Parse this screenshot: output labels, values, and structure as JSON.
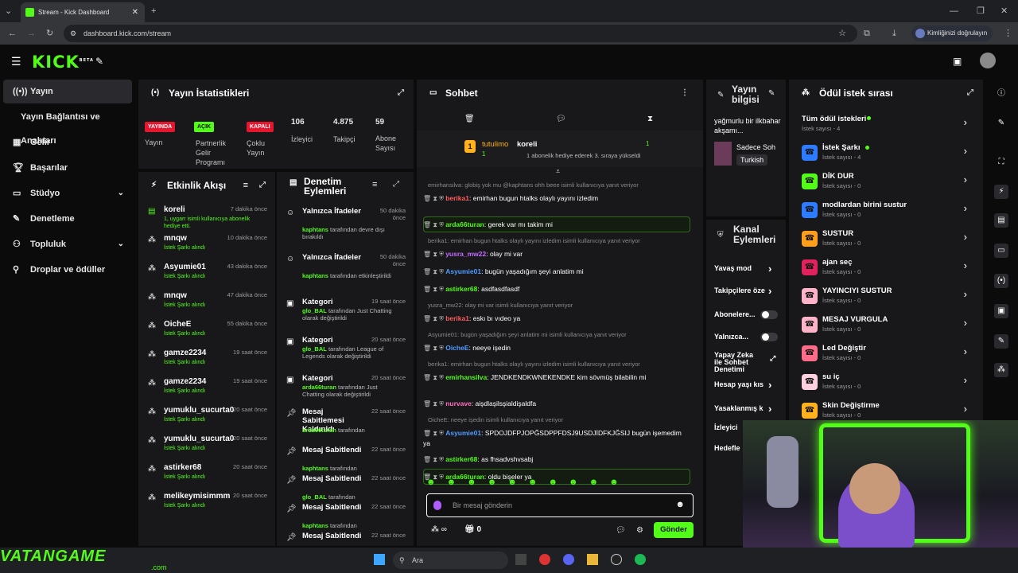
{
  "browser": {
    "tab_title": "Stream - Kick Dashboard",
    "url": "dashboard.kick.com/stream",
    "profile_label": "Kimliğinizi doğrulayın"
  },
  "app": {
    "logo": "KICK",
    "logo_sup": "BETA"
  },
  "sidebar": {
    "items": [
      {
        "label": "Yayın",
        "icon": "broadcast-icon"
      },
      {
        "label": "Yayın Bağlantısı ve Anahtarı",
        "icon": ""
      },
      {
        "label": "Gelir",
        "icon": "revenue-icon"
      },
      {
        "label": "Başarılar",
        "icon": "trophy-icon"
      },
      {
        "label": "Stüdyo",
        "icon": "studio-icon"
      },
      {
        "label": "Denetleme",
        "icon": "moderation-icon"
      },
      {
        "label": "Topluluk",
        "icon": "community-icon"
      },
      {
        "label": "Droplar ve ödüller",
        "icon": "drops-icon"
      }
    ]
  },
  "stats": {
    "title": "Yayın İstatistikleri",
    "items": [
      {
        "badge": "YAYINDA",
        "label": "Yayın"
      },
      {
        "badge": "AÇIK",
        "label": "Partnerlik Gelir Programı"
      },
      {
        "badge": "KAPALI",
        "label": "Çoklu Yayın"
      },
      {
        "value": "106",
        "label": "İzleyici"
      },
      {
        "value": "4.875",
        "label": "Takipçi"
      },
      {
        "value": "59",
        "label": "Abone Sayısı"
      }
    ]
  },
  "activity": {
    "title": "Etkinlik Akışı",
    "items": [
      {
        "name": "koreli",
        "sub": "1, uygarr isimli kullanıcıya abonelik hediye etti.",
        "time": "7 dakika önce"
      },
      {
        "name": "mnqw",
        "sub": "İstek Şarkı alındı",
        "time": "10 dakika önce"
      },
      {
        "name": "Asyumie01",
        "sub": "İstek Şarkı alındı",
        "time": "43 dakika önce"
      },
      {
        "name": "mnqw",
        "sub": "İstek Şarkı alındı",
        "time": "47 dakika önce"
      },
      {
        "name": "OicheE",
        "sub": "İstek Şarkı alındı",
        "time": "55 dakika önce"
      },
      {
        "name": "gamze2234",
        "sub": "İstek Şarkı alındı",
        "time": "19 saat önce"
      },
      {
        "name": "gamze2234",
        "sub": "İstek Şarkı alındı",
        "time": "19 saat önce"
      },
      {
        "name": "yumuklu_sucurta0",
        "sub": "İstek Şarkı alındı",
        "time": "20 saat önce"
      },
      {
        "name": "yumuklu_sucurta0",
        "sub": "İstek Şarkı alındı",
        "time": "20 saat önce"
      },
      {
        "name": "astirker68",
        "sub": "İstek Şarkı alındı",
        "time": "20 saat önce"
      },
      {
        "name": "melikeymisimmm",
        "sub": "İstek Şarkı alındı",
        "time": "20 saat önce"
      }
    ]
  },
  "modlog": {
    "title": "Denetim Eylemleri",
    "items": [
      {
        "title": "Yalnızca İfadeler",
        "actor": "kaphtans",
        "sub": "tarafından devre dışı bırakıldı",
        "time": "50 dakika önce"
      },
      {
        "title": "Yalnızca İfadeler",
        "actor": "kaphtans",
        "sub": "tarafından etkinleştirildi",
        "time": "50 dakika önce"
      },
      {
        "title": "Kategori",
        "actor": "glo_BAL",
        "sub": "tarafından Just Chatting olarak değiştirildi",
        "time": "19 saat önce"
      },
      {
        "title": "Kategori",
        "actor": "glo_BAL",
        "sub": "tarafından League of Legends olarak değiştirildi",
        "time": "20 saat önce"
      },
      {
        "title": "Kategori",
        "actor": "arda66turan",
        "sub": "tarafından Just Chatting olarak değiştirildi",
        "time": "20 saat önce"
      },
      {
        "title": "Mesaj Sabitlemesi Kaldırıldı",
        "actor": "arda66turan",
        "sub": "tarafından",
        "time": "22 saat önce"
      },
      {
        "title": "Mesaj Sabitlendi",
        "actor": "kaphtans",
        "sub": "tarafından",
        "time": "22 saat önce"
      },
      {
        "title": "Mesaj Sabitlendi",
        "actor": "glo_BAL",
        "sub": "tarafından",
        "time": "22 saat önce"
      },
      {
        "title": "Mesaj Sabitlendi",
        "actor": "kaphtans",
        "sub": "tarafından",
        "time": "22 saat önce"
      },
      {
        "title": "Mesaj Sabitlendi",
        "actor": "",
        "sub": "",
        "time": "22 saat önce"
      }
    ]
  },
  "chat": {
    "title": "Sohbet",
    "pinned": {
      "gifter": "tutulimo",
      "gifter_count": "1",
      "recipient": "koreli",
      "recipient_count": "1",
      "text": "1 abonelik hediye ederek 3. sıraya yükseldi"
    },
    "messages": [
      {
        "reply": "emirhansilva: globiş yok mu @kaphtans ohh beee isimli kullanıcıya yanıt veriyor"
      },
      {
        "user": "berika1",
        "color": "#ff5b5b",
        "text": "emirhan bugun htalks olaylı yayını izledim"
      },
      {
        "user": "arda66turan",
        "color": "#53fc18",
        "text": "gerek var mı takim mi",
        "highlight": true
      },
      {
        "reply": "berika1: emirhan bugun htalks olaylı yayını izledim isimli kullanıcıya yanıt veriyor"
      },
      {
        "user": "yusra_mw22",
        "color": "#c46cff",
        "text": "olay mi var"
      },
      {
        "user": "Asyumie01",
        "color": "#4f9cff",
        "text": "bugün yaşadığım şeyi anlatim mi"
      },
      {
        "user": "astirker68",
        "color": "#53fc18",
        "text": "asdfasdfasdf"
      },
      {
        "reply": "yusra_mw22: olay mi var isimli kullanıcıya yanıt veriyor"
      },
      {
        "user": "berika1",
        "color": "#ff5b5b",
        "text": "eskı bı vıdeo ya"
      },
      {
        "reply": "Asyumie01: bugün yaşadığım şeyi anlatim mi isimli kullanıcıya yanıt veriyor"
      },
      {
        "user": "OicheE",
        "color": "#4f9cff",
        "text": "neeye işedin"
      },
      {
        "reply": "berika1: emirhan bugun htalks olaylı yayını izledim isimli kullanıcıya yanıt veriyor"
      },
      {
        "user": "emirhansilva",
        "color": "#53fc18",
        "text": "JENDKENDKWNEKENDKE kim sövmüş bilabilin mi"
      },
      {
        "user": "nurvave",
        "color": "#ff6fbf",
        "text": "aişdlaşilsşialdişaldfa"
      },
      {
        "reply": "OicheE: neeye işedin isimli kullanıcıya yanıt veriyor"
      },
      {
        "user": "Asyumie01",
        "color": "#4f9cff",
        "text": "SPDOJDFPJOPĞSDPPFDSJ9USDJİDFKJĞSIJ bugün işemedim ya"
      },
      {
        "user": "astirker68",
        "color": "#53fc18",
        "text": "as fhsadvshvsabj"
      },
      {
        "user": "arda66turan",
        "color": "#53fc18",
        "text": "oldu bişeler ya",
        "highlight": true
      }
    ],
    "input_placeholder": "Bir mesaj gönderin",
    "points": "∞",
    "gift_count": "0",
    "send_label": "Gönder"
  },
  "stream_info": {
    "title": "Yayın bilgisi",
    "stream_title": "yağmurlu bir ilkbahar akşamı...",
    "category": "Sadece Soh",
    "language": "Turkish"
  },
  "channel_actions": {
    "title": "Kanal Eylemleri",
    "items": [
      {
        "label": "Yavaş mod",
        "control": "chevron"
      },
      {
        "label": "Takipçilere öze",
        "control": "chevron"
      },
      {
        "label": "Abonelere...",
        "control": "toggle"
      },
      {
        "label": "Yalnızca...",
        "control": "toggle"
      },
      {
        "label": "Yapay Zeka ile Sohbet Denetimi",
        "control": "external"
      },
      {
        "label": "Hesap yaşı kıs",
        "control": "chevron"
      },
      {
        "label": "Yasaklanmış k",
        "control": "chevron"
      },
      {
        "label": "İzleyici",
        "control": "none"
      },
      {
        "label": "Hedefle",
        "control": "none"
      }
    ]
  },
  "rewards": {
    "title": "Ödül istek sırası",
    "all_label": "Tüm ödül istekleri",
    "all_count": "İstek sayısı - 4",
    "items": [
      {
        "name": "İstek Şarkı",
        "count": "İstek sayısı - 4",
        "color": "#2d7bff",
        "active": true
      },
      {
        "name": "DİK DUR",
        "count": "İstek sayısı - 0",
        "color": "#53fc18"
      },
      {
        "name": "modlardan birini sustur",
        "count": "İstek sayısı - 0",
        "color": "#2d7bff"
      },
      {
        "name": "SUSTUR",
        "count": "İstek sayısı - 0",
        "color": "#ff9d1c"
      },
      {
        "name": "ajan seç",
        "count": "İstek sayısı - 0",
        "color": "#e0225f"
      },
      {
        "name": "YAYINCIYI SUSTUR",
        "count": "İstek sayısı - 0",
        "color": "#ffb3c9"
      },
      {
        "name": "MESAJ VURGULA",
        "count": "İstek sayısı - 0",
        "color": "#ffb3c9"
      },
      {
        "name": "Led Değiştir",
        "count": "İstek sayısı - 0",
        "color": "#ff6c8a"
      },
      {
        "name": "su iç",
        "count": "İstek sayısı - 0",
        "color": "#ffd1e0"
      },
      {
        "name": "Skin Değiştirme",
        "count": "İstek sayısı - 0",
        "color": "#ffb21c"
      }
    ]
  },
  "taskbar": {
    "search": "Ara",
    "watermark": "VATANGAME",
    "watermark_sub": ".com"
  }
}
